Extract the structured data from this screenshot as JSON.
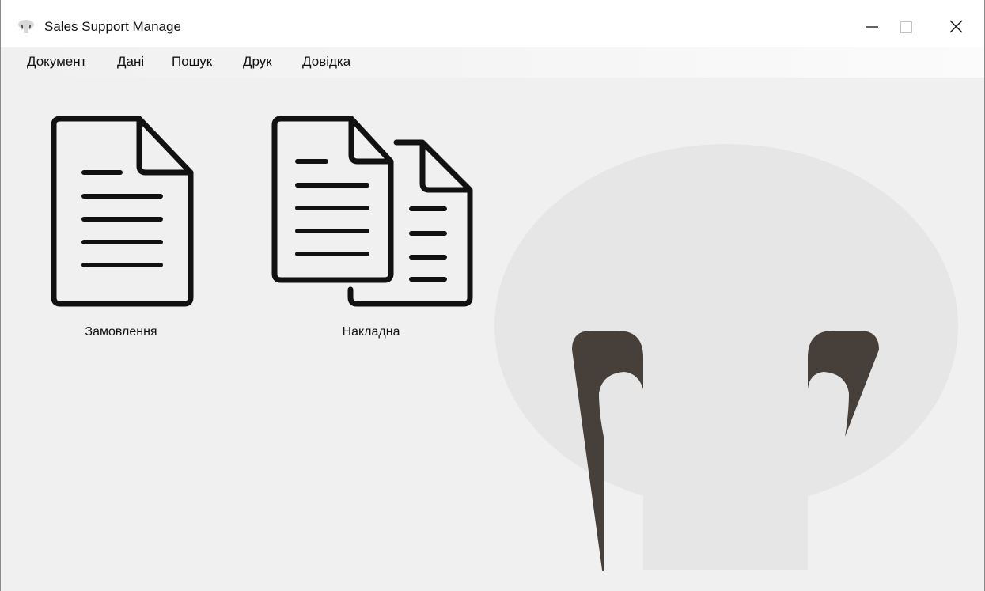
{
  "window": {
    "title": "Sales Support Manage",
    "app_icon": "mushroom-icon",
    "controls": {
      "minimize_icon": "minimize-icon",
      "maximize_icon": "maximize-icon",
      "close_icon": "close-icon"
    }
  },
  "menu": {
    "items": [
      {
        "label": "Документ"
      },
      {
        "label": "Дані"
      },
      {
        "label": "Пошук"
      },
      {
        "label": "Друк"
      },
      {
        "label": "Довідка"
      }
    ]
  },
  "tiles": [
    {
      "label": "Замовлення",
      "icon": "document-icon"
    },
    {
      "label": "Накладна",
      "icon": "documents-icon"
    }
  ],
  "background": {
    "logo_icon": "mushroom-logo",
    "cap_color": "#e6e6e6",
    "gill_color": "#463f3a"
  }
}
